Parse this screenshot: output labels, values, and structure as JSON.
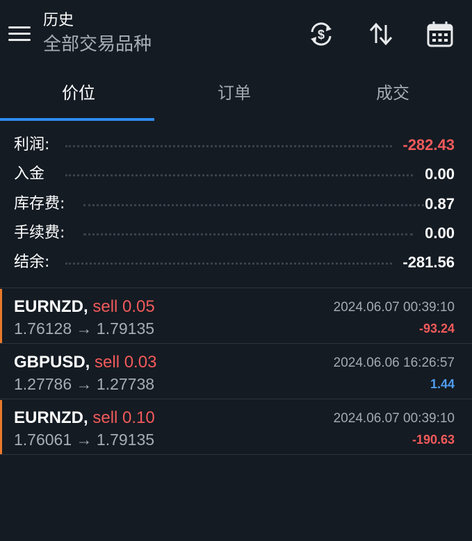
{
  "header": {
    "title": "历史",
    "subtitle": "全部交易品种",
    "icons": [
      "menu-icon",
      "currency-sync-icon",
      "sort-icon",
      "calendar-icon"
    ]
  },
  "tabs": [
    {
      "label": "价位",
      "active": true
    },
    {
      "label": "订单",
      "active": false
    },
    {
      "label": "成交",
      "active": false
    }
  ],
  "summary": [
    {
      "label": "利润:",
      "value": "-282.43",
      "color": "#f25a5a"
    },
    {
      "label": "入金",
      "value": "0.00",
      "color": "#ffffff"
    },
    {
      "label": "库存费:",
      "value": "0.87",
      "color": "#ffffff"
    },
    {
      "label": "手续费:",
      "value": "0.00",
      "color": "#ffffff"
    },
    {
      "label": "结余:",
      "value": "-281.56",
      "color": "#ffffff"
    }
  ],
  "trades": [
    {
      "symbol": "EURNZD,",
      "type": "sell 0.05",
      "open": "1.76128",
      "close": "1.79135",
      "time": "2024.06.07 00:39:10",
      "profit": "-93.24",
      "bar_color": "#e9792b"
    },
    {
      "symbol": "GBPUSD,",
      "type": "sell 0.03",
      "open": "1.27786",
      "close": "1.27738",
      "time": "2024.06.06 16:26:57",
      "profit": "1.44",
      "bar_color": "#2f8cf0"
    },
    {
      "symbol": "EURNZD,",
      "type": "sell 0.10",
      "open": "1.76061",
      "close": "1.79135",
      "time": "2024.06.07 00:39:10",
      "profit": "-190.63",
      "bar_color": "#e9792b"
    }
  ],
  "arrow": "→",
  "colors": {
    "background": "#141b23",
    "accent": "#2f8cf0",
    "negative": "#f25a5a",
    "positive": "#4f9cf0"
  }
}
